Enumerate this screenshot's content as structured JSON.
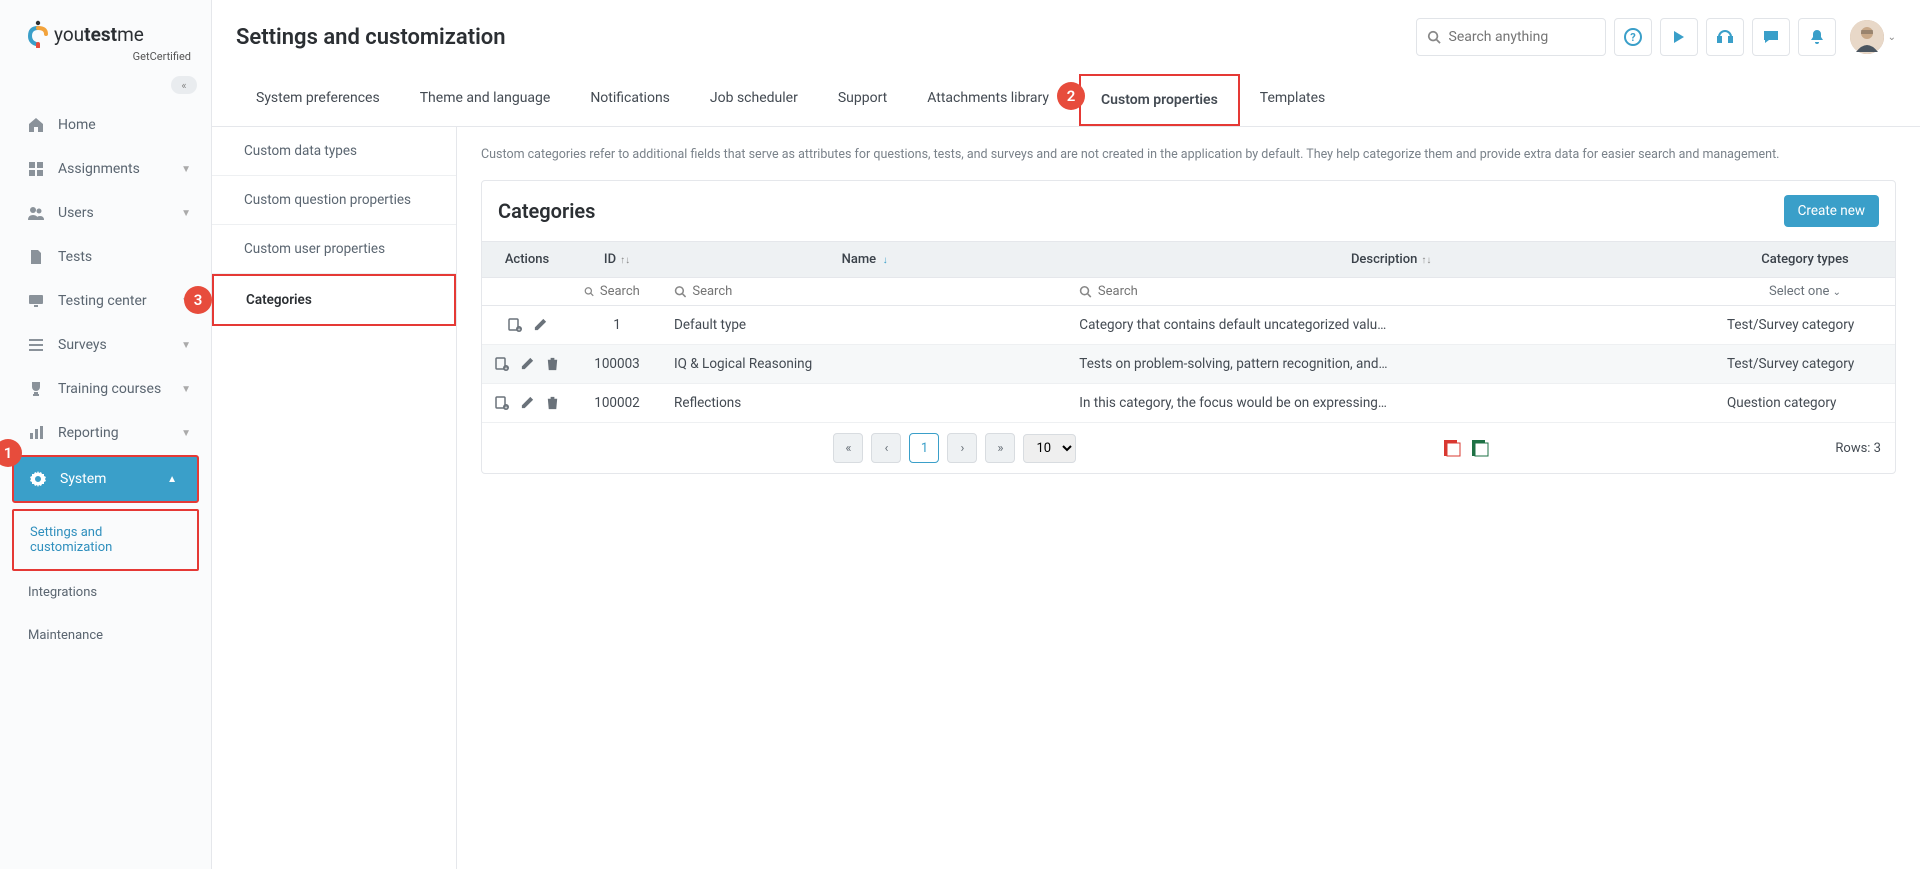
{
  "brand": {
    "name": "youtestme",
    "sub": "GetCertified"
  },
  "search_placeholder": "Search anything",
  "page_title": "Settings and customization",
  "sidebar": {
    "items": [
      {
        "label": "Home",
        "icon": "home"
      },
      {
        "label": "Assignments",
        "icon": "grid",
        "expandable": true
      },
      {
        "label": "Users",
        "icon": "users",
        "expandable": true
      },
      {
        "label": "Tests",
        "icon": "file"
      },
      {
        "label": "Testing center",
        "icon": "monitor",
        "expandable": true
      },
      {
        "label": "Surveys",
        "icon": "list",
        "expandable": true
      },
      {
        "label": "Training courses",
        "icon": "trophy",
        "expandable": true
      },
      {
        "label": "Reporting",
        "icon": "report",
        "expandable": true
      },
      {
        "label": "System",
        "icon": "gear",
        "expandable": true,
        "active": true
      }
    ],
    "system_sub": [
      {
        "label": "Settings and customization",
        "active": true
      },
      {
        "label": "Integrations"
      },
      {
        "label": "Maintenance"
      }
    ]
  },
  "tabs": [
    {
      "label": "System preferences"
    },
    {
      "label": "Theme and language"
    },
    {
      "label": "Notifications"
    },
    {
      "label": "Job scheduler"
    },
    {
      "label": "Support"
    },
    {
      "label": "Attachments library"
    },
    {
      "label": "Custom properties",
      "active": true
    },
    {
      "label": "Templates"
    }
  ],
  "subnav": [
    {
      "label": "Custom data types"
    },
    {
      "label": "Custom question properties"
    },
    {
      "label": "Custom user properties"
    },
    {
      "label": "Categories",
      "active": true
    }
  ],
  "description": "Custom categories refer to additional fields that serve as attributes for questions, tests, and surveys and are not created in the application by default. They help categorize them and provide extra data for easier search and management.",
  "card_title": "Categories",
  "create_btn": "Create new",
  "columns": {
    "actions": "Actions",
    "id": "ID",
    "name": "Name",
    "description": "Description",
    "type": "Category types"
  },
  "filter_placeholder": "Search",
  "type_filter": "Select one",
  "rows": [
    {
      "id": "1",
      "name": "Default type",
      "description": "Category that contains default uncategorized value for all…",
      "type": "Test/Survey category",
      "deletable": false
    },
    {
      "id": "100003",
      "name": "IQ & Logical Reasoning",
      "description": "Tests on problem-solving, pattern recognition, and logical…",
      "type": "Test/Survey category",
      "deletable": true
    },
    {
      "id": "100002",
      "name": "Reflections",
      "description": "In this category, the focus would be on expressing or expl…",
      "type": "Question category",
      "deletable": true
    }
  ],
  "page_current": "1",
  "page_size": "10",
  "rows_label": "Rows: 3",
  "callouts": {
    "c1": "1",
    "c2": "2",
    "c3": "3"
  }
}
